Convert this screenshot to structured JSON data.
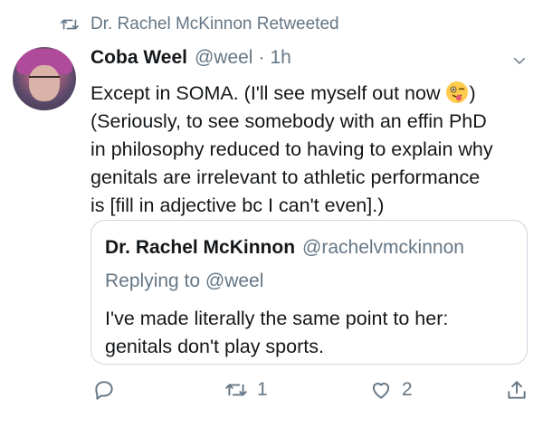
{
  "retweet_banner": {
    "text": "Dr. Rachel McKinnon Retweeted",
    "icon": "retweet-icon"
  },
  "tweet": {
    "author_name": "Coba Weel",
    "author_handle": "@weel",
    "separator": "·",
    "time": "1h",
    "text_part1": "Except in SOMA. (I'll see myself out now ",
    "emoji": "winking-tongue-emoji",
    "text_part2": ")\n(Seriously, to see somebody with an effin PhD\nin philosophy reduced to having to explain why\ngenitals are irrelevant to athletic performance\nis [fill in adjective bc I can't even].)"
  },
  "quoted_tweet": {
    "author_name": "Dr. Rachel McKinnon",
    "author_handle": "@rachelvmckinnon",
    "replying_to": "Replying to @weel",
    "text": "I've made literally the same point to her:\ngenitals don't play sports."
  },
  "actions": {
    "reply_icon": "reply-icon",
    "retweet_icon": "retweet-icon",
    "retweet_count": "1",
    "like_icon": "heart-icon",
    "like_count": "2",
    "share_icon": "share-icon"
  },
  "colors": {
    "secondary_text": "#657786",
    "primary_text": "#14171a",
    "border": "#ccd6dd"
  }
}
